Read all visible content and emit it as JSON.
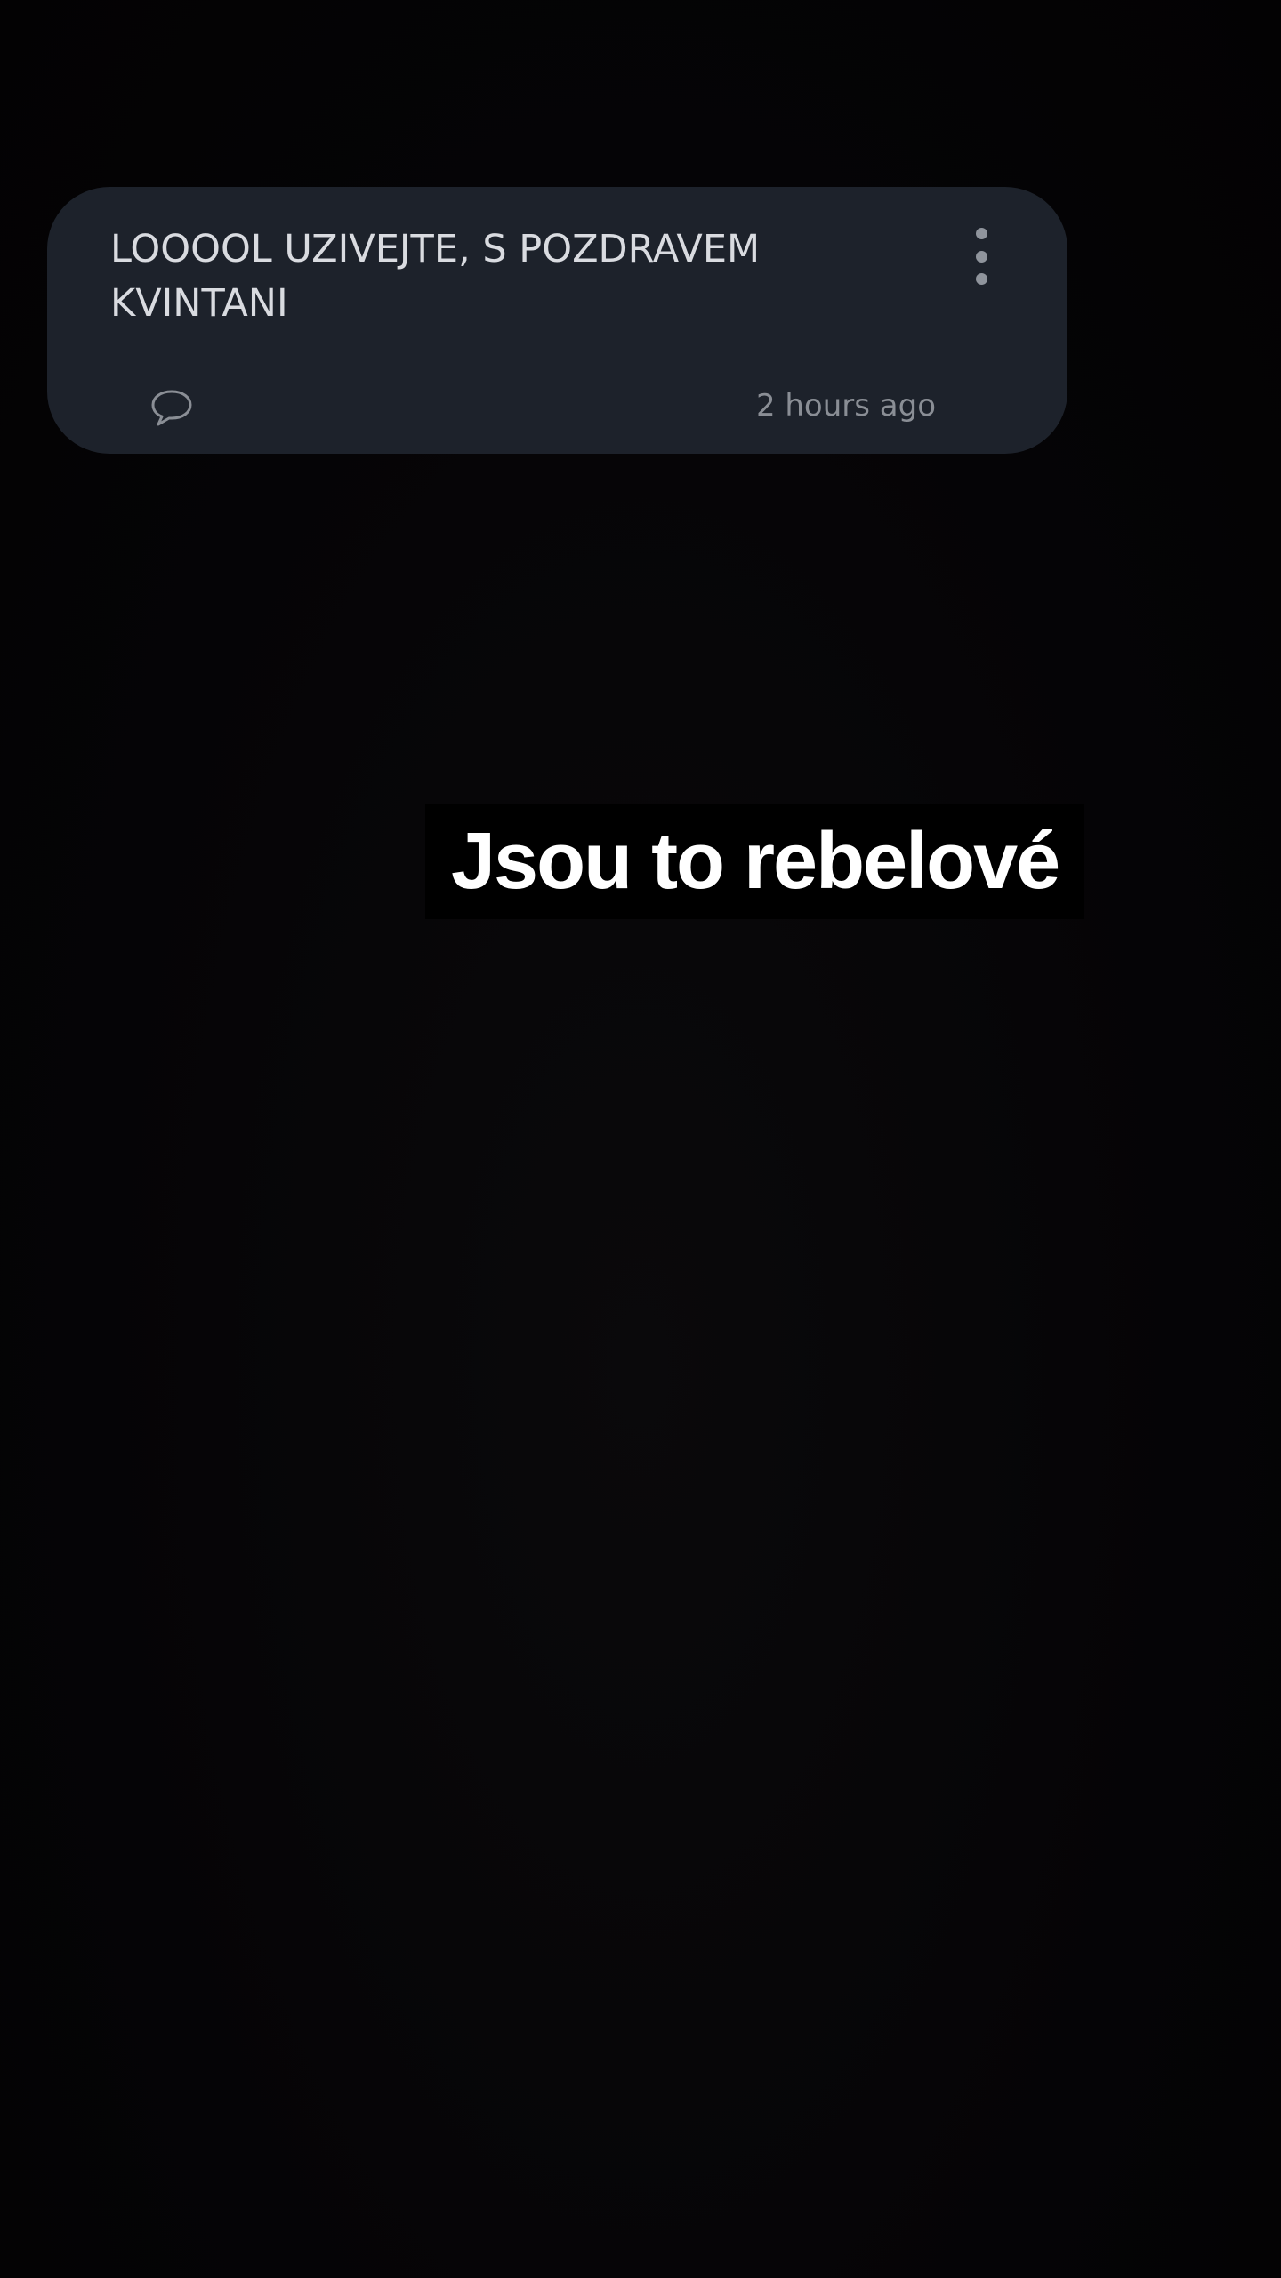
{
  "notification": {
    "message": "LOOOOL UZIVEJTE, S POZDRAVEM KVINTANI",
    "timestamp": "2 hours ago",
    "more_icon": "more-vertical-icon",
    "comment_icon": "comment-bubble-icon"
  },
  "caption": {
    "text": "Jsou to rebelové"
  },
  "colors": {
    "background": "#050406",
    "card": "#1d222b",
    "card_text": "#d9dbe0",
    "secondary_text": "#8a8e95",
    "caption_bg": "#000000",
    "caption_text": "#ffffff"
  }
}
